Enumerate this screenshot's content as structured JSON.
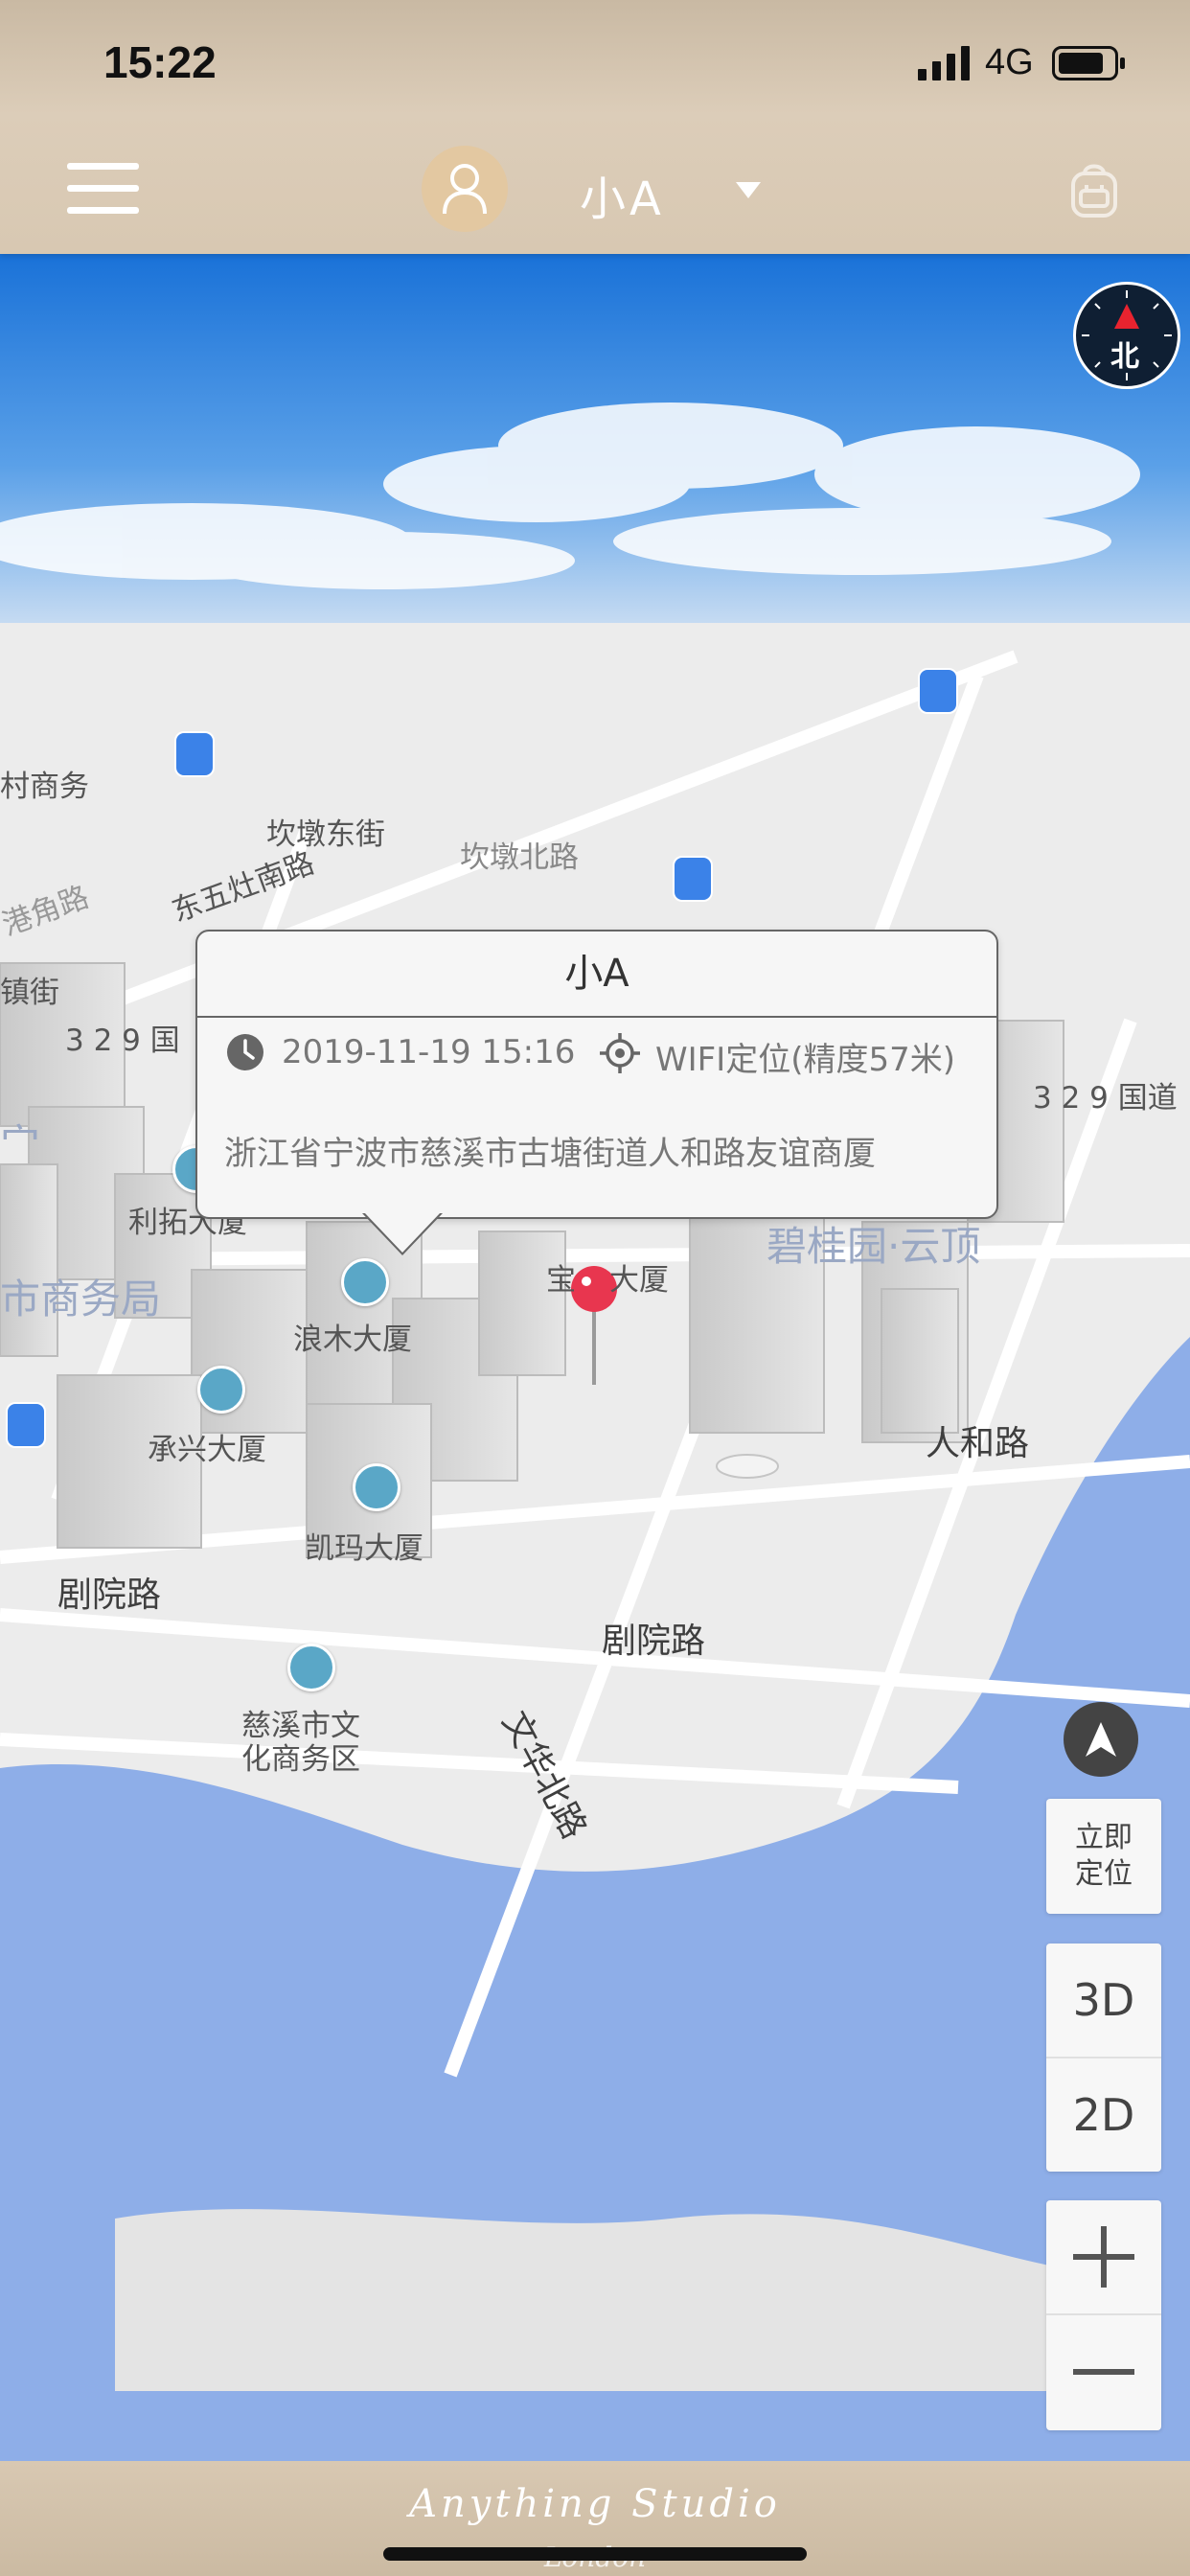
{
  "status_bar": {
    "time": "15:22",
    "network": "4G"
  },
  "header": {
    "device_name": "小A",
    "avatar_icon": "user-avatar-icon",
    "menu_icon": "hamburger-menu-icon",
    "right_icon": "backpack-icon"
  },
  "compass": {
    "label": "北"
  },
  "popup": {
    "title": "小A",
    "time": "2019-11-19 15:16",
    "method": "WIFI定位(精度57米)",
    "address": "浙江省宁波市慈溪市古塘街道人和路友谊商厦"
  },
  "map": {
    "labels": [
      "村商务",
      "坎墩东街",
      "坎墩北路",
      "东五灶南路",
      "港角路",
      "镇街",
      "3 2 9 国",
      "3 2 9 国道",
      "宀",
      "利拓大厦",
      "市商务局",
      "宝",
      "大厦",
      "碧桂园·云顶",
      "浪木大厦",
      "承兴大厦",
      "人和路",
      "文华北路",
      "凯玛大厦",
      "剧院路",
      "剧院路",
      "慈溪市文",
      "化商务区"
    ]
  },
  "controls": {
    "locate_now": [
      "立即",
      "定位"
    ],
    "view_3d": "3D",
    "view_2d": "2D"
  },
  "footer": {
    "brand": "Anything Studio",
    "brand_sub": "London"
  },
  "colors": {
    "header_bg": "#d8c8b2",
    "water": "#8eaee8",
    "pin": "#e8364f",
    "poi": "#5aa7c7",
    "bus": "#3b82e8"
  }
}
